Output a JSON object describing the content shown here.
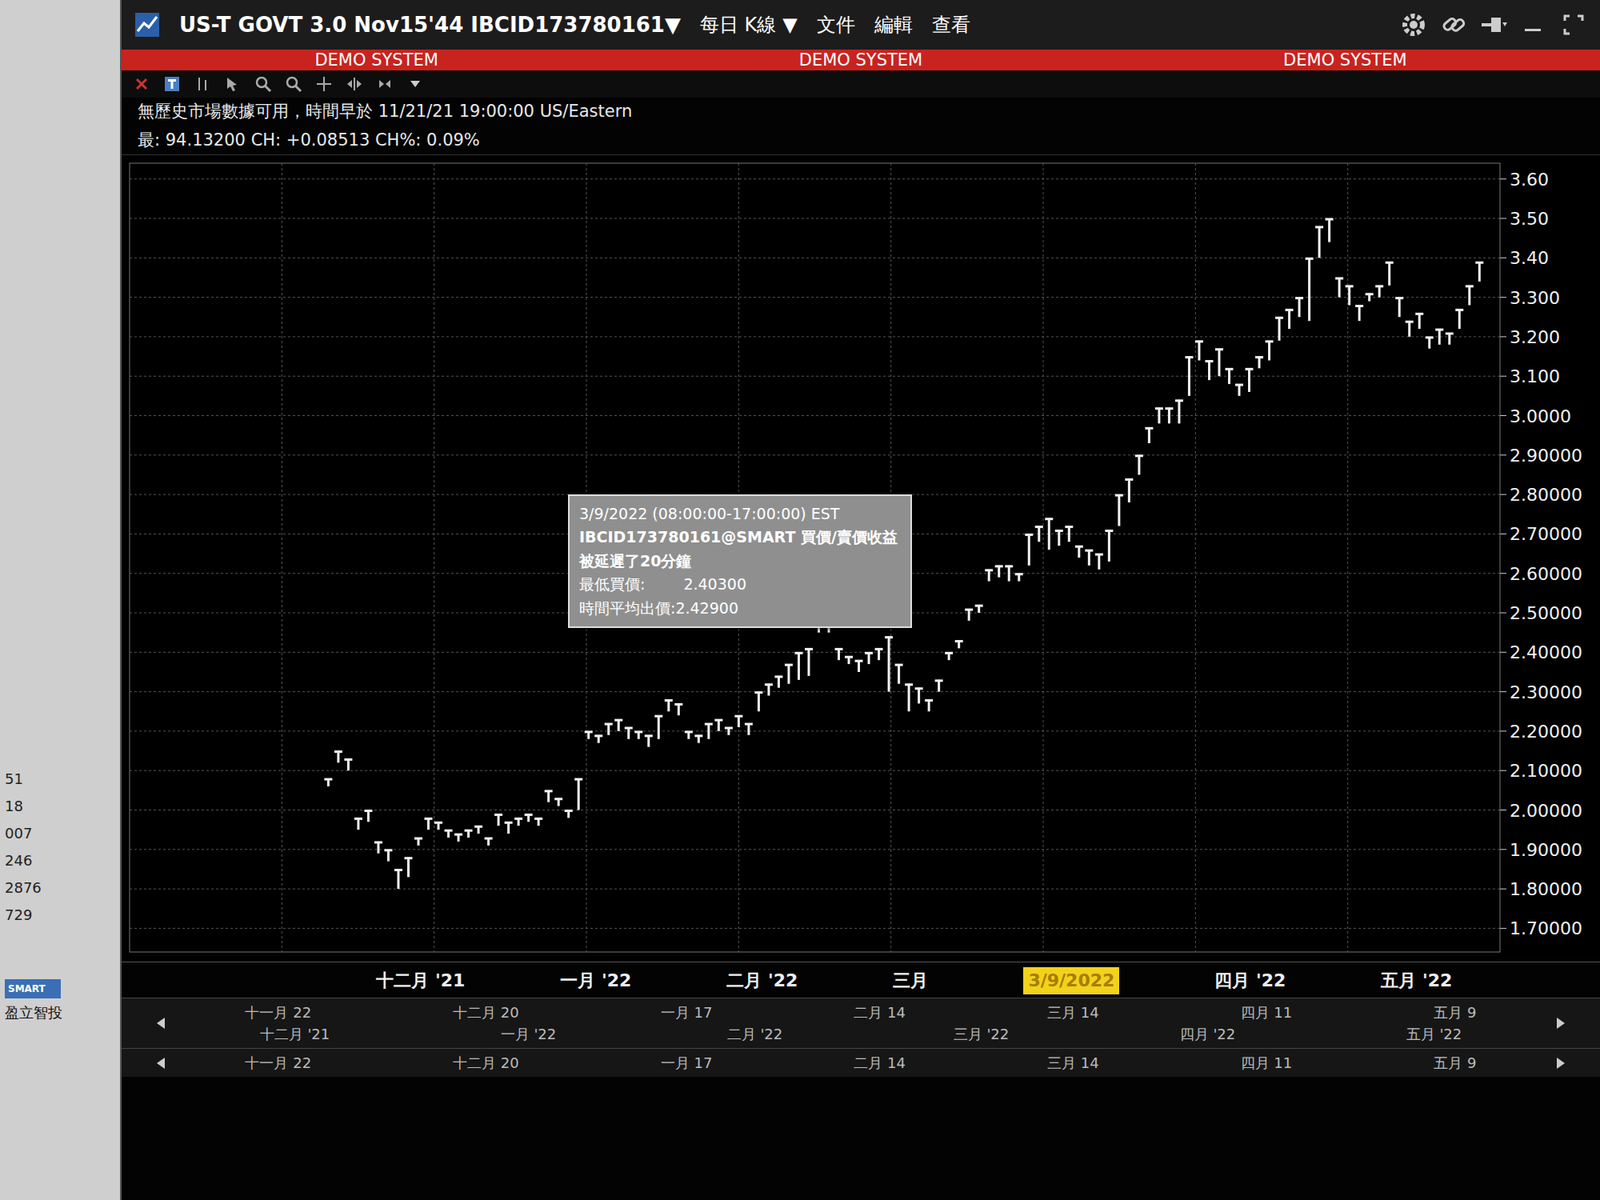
{
  "window": {
    "title": "US-T GOVT 3.0 Nov15'44 IBCID173780161",
    "title_arrow": "▼",
    "period": "每日 K線",
    "period_arrow": "▼",
    "menus": [
      "文件",
      "編輯",
      "查看"
    ],
    "demo_labels": [
      "DEMO SYSTEM",
      "DEMO SYSTEM",
      "DEMO SYSTEM"
    ]
  },
  "side_panel": {
    "numbers": [
      "51",
      "18",
      "007",
      "246",
      "2876",
      "729"
    ],
    "logo": "SMART",
    "brand": "盈立智投"
  },
  "info": {
    "notice": "無歷史市場數據可用，時間早於 11/21/21 19:00:00 US/Eastern",
    "quote": "最: 94.13200 CH: +0.08513 CH%: 0.09%"
  },
  "chart": {
    "y_ticks": [
      "3.60",
      "3.50",
      "3.40",
      "3.300",
      "3.200",
      "3.100",
      "3.0000",
      "2.90000",
      "2.80000",
      "2.70000",
      "2.60000",
      "2.50000",
      "2.40000",
      "2.30000",
      "2.20000",
      "2.10000",
      "2.00000",
      "1.90000",
      "1.80000",
      "1.70000"
    ],
    "x_labels": [
      {
        "label": "十二月 '21",
        "selected": false
      },
      {
        "label": "一月 '22",
        "selected": false
      },
      {
        "label": "二月 '22",
        "selected": false
      },
      {
        "label": "三月",
        "selected": false
      },
      {
        "label": "3/9/2022",
        "selected": true
      },
      {
        "label": "四月 '22",
        "selected": false
      },
      {
        "label": "五月 '22",
        "selected": false
      }
    ],
    "series": {
      "close": [
        2.08,
        2.15,
        2.13,
        1.98,
        2.0,
        1.92,
        1.9,
        1.85,
        1.88,
        1.93,
        1.98,
        1.97,
        1.95,
        1.94,
        1.95,
        1.96,
        1.93,
        1.99,
        1.97,
        1.98,
        1.99,
        1.98,
        2.05,
        2.03,
        2.0,
        2.08,
        2.2,
        2.19,
        2.22,
        2.23,
        2.21,
        2.2,
        2.19,
        2.24,
        2.28,
        2.27,
        2.2,
        2.19,
        2.22,
        2.23,
        2.21,
        2.24,
        2.22,
        2.3,
        2.32,
        2.34,
        2.37,
        2.4,
        2.41,
        2.47,
        2.48,
        2.41,
        2.39,
        2.38,
        2.4,
        2.41,
        2.44,
        2.37,
        2.32,
        2.31,
        2.28,
        2.33,
        2.4,
        2.43,
        2.51,
        2.52,
        2.61,
        2.62,
        2.62,
        2.6,
        2.7,
        2.72,
        2.74,
        2.71,
        2.72,
        2.67,
        2.66,
        2.65,
        2.71,
        2.8,
        2.84,
        2.9,
        2.97,
        3.02,
        3.02,
        3.04,
        3.15,
        3.19,
        3.14,
        3.17,
        3.12,
        3.08,
        3.12,
        3.15,
        3.19,
        3.25,
        3.27,
        3.3,
        3.4,
        3.48,
        3.5,
        3.35,
        3.33,
        3.28,
        3.31,
        3.33,
        3.39,
        3.3,
        3.24,
        3.26,
        3.2,
        3.22,
        3.21,
        3.27,
        3.33,
        3.39
      ],
      "low": [
        2.06,
        2.12,
        2.1,
        1.95,
        1.97,
        1.89,
        1.87,
        1.8,
        1.83,
        1.91,
        1.95,
        1.95,
        1.93,
        1.92,
        1.93,
        1.94,
        1.91,
        1.96,
        1.94,
        1.96,
        1.97,
        1.96,
        2.02,
        2.01,
        1.98,
        2.0,
        2.18,
        2.17,
        2.19,
        2.2,
        2.18,
        2.18,
        2.16,
        2.18,
        2.25,
        2.24,
        2.18,
        2.17,
        2.18,
        2.2,
        2.19,
        2.21,
        2.19,
        2.25,
        2.29,
        2.31,
        2.32,
        2.33,
        2.34,
        2.45,
        2.45,
        2.38,
        2.37,
        2.35,
        2.37,
        2.38,
        2.3,
        2.32,
        2.25,
        2.27,
        2.25,
        2.3,
        2.38,
        2.41,
        2.48,
        2.5,
        2.58,
        2.59,
        2.58,
        2.58,
        2.62,
        2.68,
        2.66,
        2.67,
        2.68,
        2.64,
        2.62,
        2.61,
        2.63,
        2.72,
        2.78,
        2.85,
        2.93,
        2.98,
        2.98,
        2.98,
        3.05,
        3.14,
        3.09,
        3.1,
        3.08,
        3.05,
        3.06,
        3.12,
        3.14,
        3.19,
        3.22,
        3.25,
        3.24,
        3.4,
        3.44,
        3.3,
        3.28,
        3.24,
        3.29,
        3.3,
        3.33,
        3.25,
        3.2,
        3.22,
        3.17,
        3.18,
        3.18,
        3.22,
        3.28,
        3.34
      ]
    },
    "tooltip": {
      "date": "3/9/2022 (08:00:00-17:00:00) EST",
      "contract": "IBCID173780161@SMART 買價/賣價收益",
      "delay": "被延遲了20分鐘",
      "low_bid_label": "最低買價:",
      "low_bid_value": "2.40300",
      "avg_ask": "時間平均出價:2.42900"
    }
  },
  "navigator": {
    "rows": [
      {
        "minor": [
          "十一月 22",
          "十二月 20",
          "一月 17",
          "二月 14",
          "三月 14",
          "四月 11",
          "五月 9"
        ],
        "major": [
          "十二月 '21",
          "一月 '22",
          "二月 '22",
          "三月 '22",
          "四月 '22",
          "五月 '22"
        ]
      },
      {
        "minor": [
          "十一月 22",
          "十二月 20",
          "一月 17",
          "二月 14",
          "三月 14",
          "四月 11",
          "五月 9"
        ],
        "major": []
      }
    ]
  }
}
